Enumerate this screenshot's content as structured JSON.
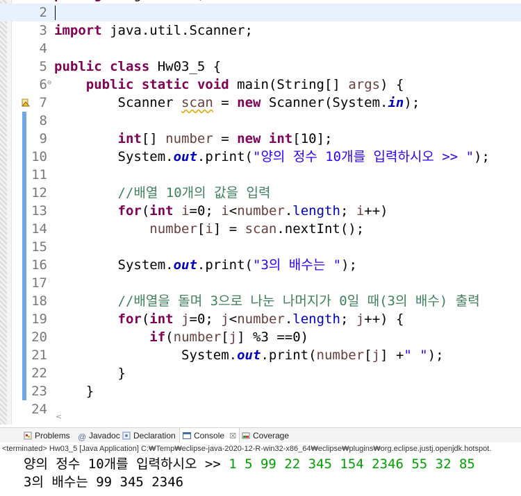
{
  "editor": {
    "top_line": "package algorithms;",
    "lines": [
      {
        "n": "2",
        "html": ""
      },
      {
        "n": "3",
        "html": "<span class='kw'>import</span> java.util.Scanner;"
      },
      {
        "n": "4",
        "html": ""
      },
      {
        "n": "5",
        "html": "<span class='kw'>public</span> <span class='kw'>class</span> Hw03_5 {"
      },
      {
        "n": "6",
        "html": "    <span class='kw'>public</span> <span class='kw'>static</span> <span class='kw'>void</span> main(String[] <span class='var'>args</span>) {"
      },
      {
        "n": "7",
        "html": "        Scanner <span class='var squig'>scan</span> = <span class='kw'>new</span> Scanner(System.<span class='sfld'>in</span>);"
      },
      {
        "n": "8",
        "html": ""
      },
      {
        "n": "9",
        "html": "        <span class='kw'>int</span>[] <span class='var'>number</span> = <span class='kw'>new</span> <span class='kw'>int</span>[10];"
      },
      {
        "n": "10",
        "html": "        System.<span class='sfld'>out</span>.print(<span class='str'>\"양의 정수 10개를 입력하시오 &gt;&gt; \"</span>);"
      },
      {
        "n": "11",
        "html": ""
      },
      {
        "n": "12",
        "html": "        <span class='com'>//배열 10개의 값을 입력</span>"
      },
      {
        "n": "13",
        "html": "        <span class='kw'>for</span>(<span class='kw'>int</span> <span class='var'>i</span>=0; <span class='var'>i</span>&lt;<span class='var'>number</span>.<span class='fld'>length</span>; <span class='var'>i</span>++)"
      },
      {
        "n": "14",
        "html": "            <span class='var'>number</span>[<span class='var'>i</span>] = <span class='var'>scan</span>.nextInt();"
      },
      {
        "n": "15",
        "html": ""
      },
      {
        "n": "16",
        "html": "        System.<span class='sfld'>out</span>.print(<span class='str'>\"3의 배수는 \"</span>);"
      },
      {
        "n": "17",
        "html": ""
      },
      {
        "n": "18",
        "html": "        <span class='com'>//배열을 돌며 3으로 나눈 나머지가 0일 때(3의 배수) 출력</span>"
      },
      {
        "n": "19",
        "html": "        <span class='kw'>for</span>(<span class='kw'>int</span> <span class='var'>j</span>=0; <span class='var'>j</span>&lt;<span class='var'>number</span>.<span class='fld'>length</span>; <span class='var'>j</span>++) {"
      },
      {
        "n": "20",
        "html": "            <span class='kw'>if</span>(<span class='var'>number</span>[<span class='var'>j</span>] %3 ==0)"
      },
      {
        "n": "21",
        "html": "                System.<span class='sfld'>out</span>.print(<span class='var'>number</span>[<span class='var'>j</span>] +<span class='str'>\" \"</span>);"
      },
      {
        "n": "22",
        "html": "        }"
      },
      {
        "n": "23",
        "html": "    }"
      },
      {
        "n": "24",
        "html": ""
      }
    ]
  },
  "views": {
    "problems": "Problems",
    "javadoc": "Javadoc",
    "declaration": "Declaration",
    "console": "Console",
    "console_close": "☒",
    "coverage": "Coverage"
  },
  "console": {
    "status": "<terminated> Hw03_5 [Java Application] C:₩Temp₩eclipse-java-2020-12-R-win32-x86_64₩eclipse₩plugins₩org.eclipse.justj.openjdk.hotspot.",
    "prompt": "양의 정수 10개를 입력하시오 >> ",
    "input": "1 5 99 22 345 154 2346 55 32 85",
    "result": "3의 배수는 99 345 2346"
  }
}
